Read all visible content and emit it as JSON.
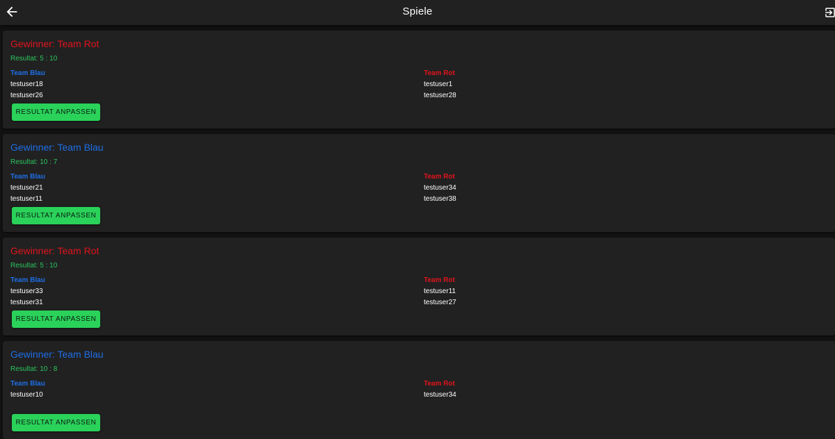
{
  "header": {
    "title": "Spiele",
    "back_icon": "arrow-left-icon",
    "logout_icon": "logout-icon"
  },
  "colors": {
    "red": "#e0141c",
    "blue": "#1e6ee6",
    "green": "#2bc55e",
    "button": "#2ad25a"
  },
  "games": [
    {
      "winner": "Gewinner: Team Rot",
      "winner_color": "red",
      "result": "Resultat: 5 : 10",
      "left_team": {
        "name": "Team Blau",
        "color": "blue",
        "players": [
          "testuser18",
          "testuser26"
        ]
      },
      "right_team": {
        "name": "Team Rot",
        "color": "red",
        "players": [
          "testuser1",
          "testuser28"
        ]
      },
      "button_label": "RESULTAT ANPASSEN"
    },
    {
      "winner": "Gewinner: Team Blau",
      "winner_color": "blue",
      "result": "Resultat: 10 : 7",
      "left_team": {
        "name": "Team Blau",
        "color": "blue",
        "players": [
          "testuser21",
          "testuser11"
        ]
      },
      "right_team": {
        "name": "Team Rot",
        "color": "red",
        "players": [
          "testuser34",
          "testuser38"
        ]
      },
      "button_label": "RESULTAT ANPASSEN"
    },
    {
      "winner": "Gewinner: Team Rot",
      "winner_color": "red",
      "result": "Resultat: 5 : 10",
      "left_team": {
        "name": "Team Blau",
        "color": "blue",
        "players": [
          "testuser33",
          "testuser31"
        ]
      },
      "right_team": {
        "name": "Team Rot",
        "color": "red",
        "players": [
          "testuser11",
          "testuser27"
        ]
      },
      "button_label": "RESULTAT ANPASSEN"
    },
    {
      "winner": "Gewinner: Team Blau",
      "winner_color": "blue",
      "result": "Resultat: 10 : 8",
      "left_team": {
        "name": "Team Blau",
        "color": "blue",
        "players": [
          "testuser10"
        ]
      },
      "right_team": {
        "name": "Team Rot",
        "color": "red",
        "players": [
          "testuser34"
        ]
      },
      "button_label": "RESULTAT ANPASSEN"
    }
  ]
}
